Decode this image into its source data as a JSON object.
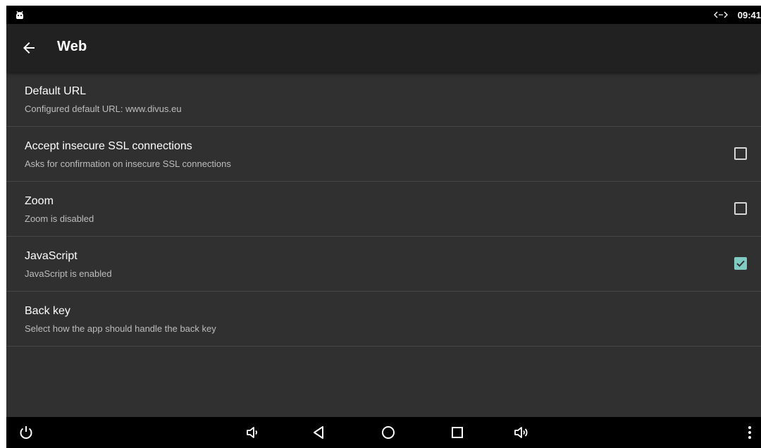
{
  "status_bar": {
    "app_icon": "android-debug-icon",
    "sync_icon": "sync-arrows-icon",
    "time": "09:41"
  },
  "toolbar": {
    "back_icon": "arrow-back-icon",
    "title": "Web"
  },
  "preferences": [
    {
      "title": "Default URL",
      "summary": "Configured default URL: www.divus.eu",
      "has_checkbox": false
    },
    {
      "title": "Accept insecure SSL connections",
      "summary": "Asks for confirmation on insecure SSL connections",
      "has_checkbox": true,
      "checked": false
    },
    {
      "title": "Zoom",
      "summary": "Zoom is disabled",
      "has_checkbox": true,
      "checked": false
    },
    {
      "title": "JavaScript",
      "summary": "JavaScript is enabled",
      "has_checkbox": true,
      "checked": true
    },
    {
      "title": "Back key",
      "summary": "Select how the app should handle the back key",
      "has_checkbox": false
    }
  ],
  "nav_bar": {
    "icons": [
      "power-icon",
      "volume-down-icon",
      "back-triangle-icon",
      "home-circle-icon",
      "recents-square-icon",
      "volume-up-icon",
      "overflow-menu-icon"
    ]
  },
  "colors": {
    "background": "#303030",
    "toolbar": "#212121",
    "accent": "#80cbc4",
    "divider": "#474747",
    "summary_text": "#bdbdbd"
  }
}
